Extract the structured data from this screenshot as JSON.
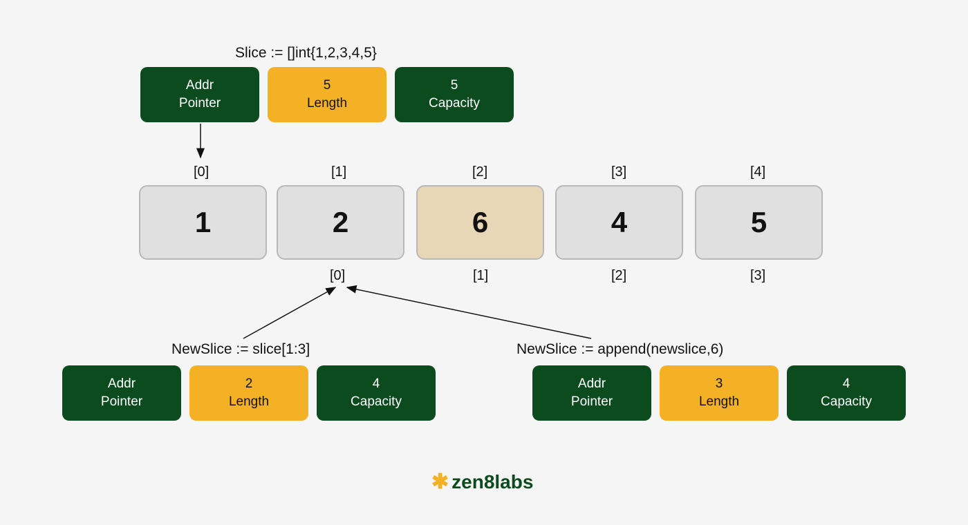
{
  "topCode": "Slice := []int{1,2,3,4,5}",
  "topHeader": {
    "pointer": {
      "value": "Addr",
      "label": "Pointer"
    },
    "length": {
      "value": "5",
      "label": "Length"
    },
    "capacity": {
      "value": "5",
      "label": "Capacity"
    }
  },
  "array": {
    "topIndices": [
      "[0]",
      "[1]",
      "[2]",
      "[3]",
      "[4]"
    ],
    "values": [
      "1",
      "2",
      "6",
      "4",
      "5"
    ],
    "highlightIndex": 2,
    "bottomIndices": [
      "[0]",
      "[1]",
      "[2]",
      "[3]"
    ]
  },
  "leftCode": "NewSlice := slice[1:3]",
  "leftHeader": {
    "pointer": {
      "value": "Addr",
      "label": "Pointer"
    },
    "length": {
      "value": "2",
      "label": "Length"
    },
    "capacity": {
      "value": "4",
      "label": "Capacity"
    }
  },
  "rightCode": "NewSlice := append(newslice,6)",
  "rightHeader": {
    "pointer": {
      "value": "Addr",
      "label": "Pointer"
    },
    "length": {
      "value": "3",
      "label": "Length"
    },
    "capacity": {
      "value": "4",
      "label": "Capacity"
    }
  },
  "logo": "zen8labs",
  "colors": {
    "green": "#0b4b1e",
    "orange": "#f5b125",
    "cell": "#e0e0e0",
    "cellHighlight": "#e8d7b6",
    "bg": "#f5f5f5"
  }
}
